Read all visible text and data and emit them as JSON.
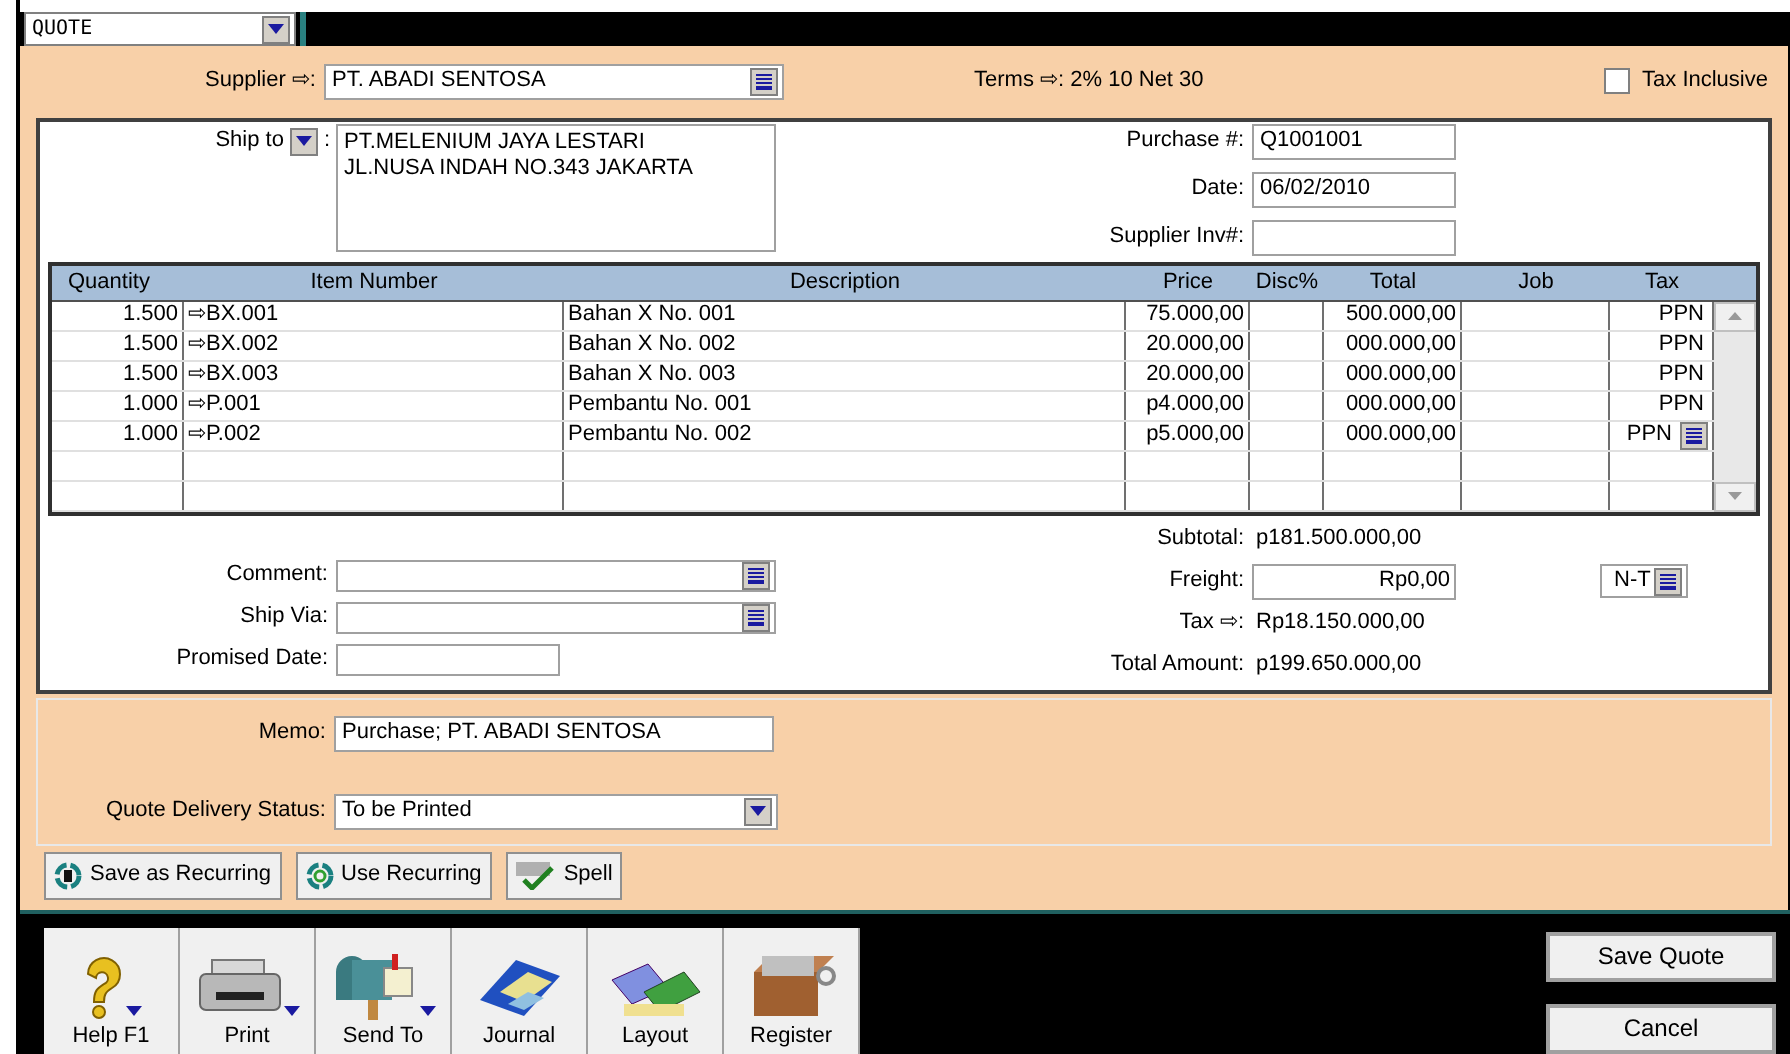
{
  "form_type": {
    "value": "QUOTE"
  },
  "supplier": {
    "label": "Supplier ⇨:",
    "value": "PT. ABADI SENTOSA"
  },
  "terms": {
    "label": "Terms ⇨:",
    "value": "2% 10 Net 30"
  },
  "tax_inclusive": {
    "label": "Tax Inclusive",
    "checked": false
  },
  "ship_to": {
    "label": "Ship to",
    "colon": ":",
    "lines": [
      "PT.MELENIUM JAYA LESTARI",
      "JL.NUSA INDAH NO.343 JAKARTA"
    ]
  },
  "header_fields": [
    {
      "label": "Purchase #:",
      "value": "Q1001001"
    },
    {
      "label": "Date:",
      "value": "06/02/2010"
    },
    {
      "label": "Supplier Inv#:"
    }
  ],
  "table": {
    "columns": [
      "Quantity",
      "Item Number",
      "Description",
      "Price",
      "Disc%",
      "Total",
      "Job",
      "Tax"
    ],
    "rows": [
      {
        "quantity": "1.500",
        "item_number": "⇨BX.001",
        "description": "Bahan X No. 001",
        "price": "75.000,00",
        "total": "500.000,00",
        "tax": "PPN",
        "active": false
      },
      {
        "quantity": "1.500",
        "item_number": "⇨BX.002",
        "description": "Bahan X No. 002",
        "price": "20.000,00",
        "total": "000.000,00",
        "tax": "PPN",
        "active": false
      },
      {
        "quantity": "1.500",
        "item_number": "⇨BX.003",
        "description": "Bahan X No. 003",
        "price": "20.000,00",
        "total": "000.000,00",
        "tax": "PPN",
        "active": false
      },
      {
        "quantity": "1.000",
        "item_number": "⇨P.001",
        "description": "Pembantu No. 001",
        "price": "p4.000,00",
        "total": "000.000,00",
        "tax": "PPN",
        "active": false
      },
      {
        "quantity": "1.000",
        "item_number": "⇨P.002",
        "description": "Pembantu No. 002",
        "price": "p5.000,00",
        "total": "000.000,00",
        "tax": "PPN",
        "active": true
      }
    ]
  },
  "extra_fields": [
    {
      "label": "Comment:",
      "kind": "combo"
    },
    {
      "label": "Ship Via:",
      "kind": "combo"
    },
    {
      "label": "Promised Date:",
      "kind": "field"
    }
  ],
  "totals": [
    {
      "label": "Subtotal:",
      "value": "p181.500.000,00",
      "kind": "text"
    },
    {
      "label": "Freight:",
      "value": "Rp0,00",
      "kind": "field",
      "tax_code": "N-T"
    },
    {
      "label": "Tax ⇨:",
      "value": "Rp18.150.000,00",
      "kind": "text"
    },
    {
      "label": "Total Amount:",
      "value": "p199.650.000,00",
      "kind": "text"
    }
  ],
  "memo": {
    "label": "Memo:",
    "value": "Purchase; PT. ABADI SENTOSA"
  },
  "delivery_status": {
    "label": "Quote Delivery Status:",
    "value": "To be Printed"
  },
  "action_buttons": [
    {
      "label": "Save as Recurring",
      "kind": "save"
    },
    {
      "label": "Use Recurring",
      "kind": "use"
    },
    {
      "label": "Spell",
      "kind": "spell"
    }
  ],
  "toolbar": [
    {
      "label": "Help F1",
      "kind": "help",
      "menu": true
    },
    {
      "label": "Print",
      "kind": "print",
      "menu": true
    },
    {
      "label": "Send To",
      "kind": "send",
      "menu": true
    },
    {
      "label": "Journal",
      "kind": "journal",
      "menu": false
    },
    {
      "label": "Layout",
      "kind": "layout",
      "menu": false
    },
    {
      "label": "Register",
      "kind": "register",
      "menu": false
    }
  ],
  "dialog_buttons": [
    "Save Quote",
    "Cancel"
  ]
}
